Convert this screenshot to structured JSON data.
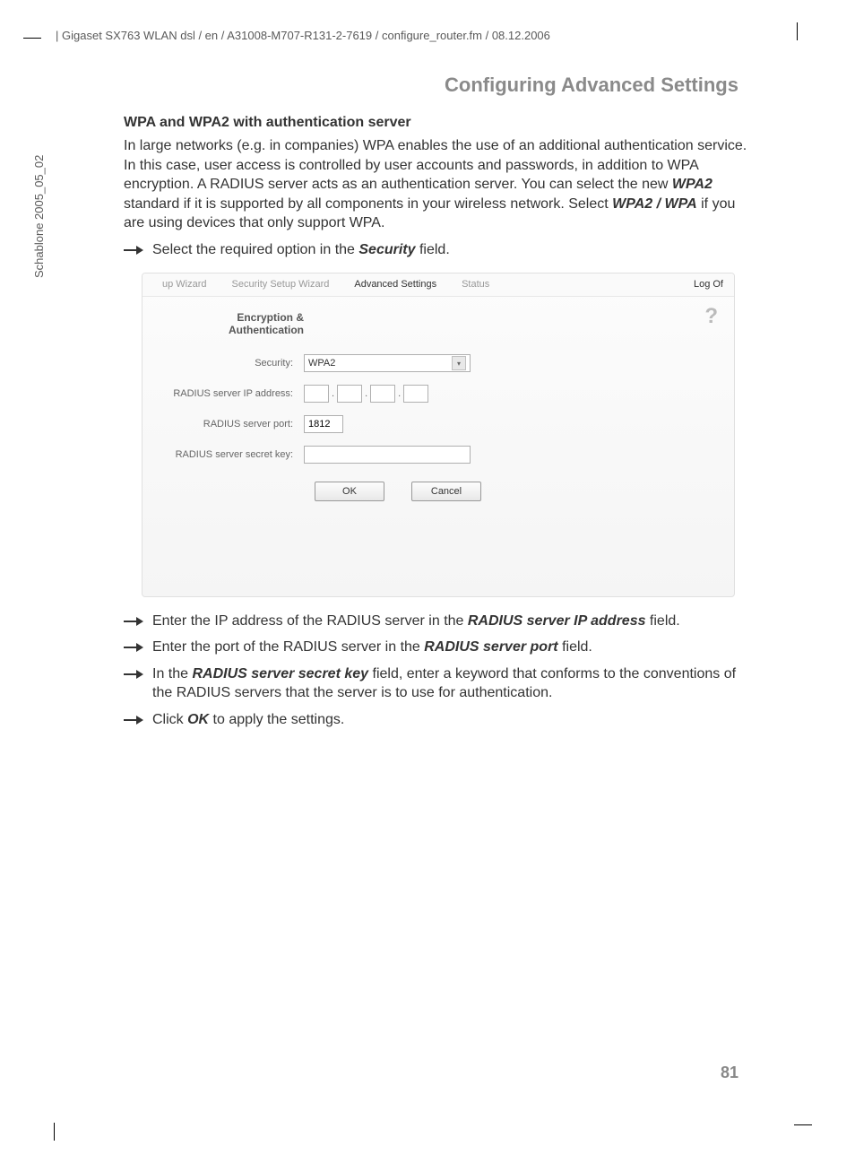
{
  "header_path": "Gigaset SX763 WLAN dsl / en / A31008-M707-R131-2-7619 / configure_router.fm / 08.12.2006",
  "vertical_note": "Schablone 2005_05_02",
  "section_title": "Configuring Advanced Settings",
  "subheading": "WPA and WPA2 with authentication server",
  "intro_1": "In large networks (e.g. in companies) WPA enables the use of an additional authentication service. In this case, user access is controlled by user accounts and passwords, in addition to WPA encryption. A RADIUS server acts as an authentication server. You can select the new ",
  "intro_bold1": "WPA2",
  "intro_2": " standard if it is supported by all components in your wireless network. Select ",
  "intro_bold2": "WPA2 / WPA",
  "intro_3": " if you are using devices that only support WPA.",
  "bullet1_a": "Select the required option in the ",
  "bullet1_bold": "Security",
  "bullet1_b": " field.",
  "tabs": {
    "t1": "up Wizard",
    "t2": "Security Setup Wizard",
    "t3": "Advanced Settings",
    "t4": "Status",
    "logoff": "Log Of"
  },
  "form": {
    "title_line1": "Encryption &",
    "title_line2": "Authentication",
    "security_label": "Security:",
    "security_value": "WPA2",
    "radius_ip_label": "RADIUS server IP address:",
    "radius_port_label": "RADIUS server port:",
    "radius_port_value": "1812",
    "radius_secret_label": "RADIUS server secret key:",
    "ok_button": "OK",
    "cancel_button": "Cancel",
    "help": "?"
  },
  "bullet2_a": "Enter the IP address of the RADIUS server in the ",
  "bullet2_bold": "RADIUS server IP address",
  "bullet2_b": " field.",
  "bullet3_a": "Enter the port of the RADIUS server in the ",
  "bullet3_bold": "RADIUS server port",
  "bullet3_b": " field.",
  "bullet4_a": "In the ",
  "bullet4_bold": "RADIUS server secret key",
  "bullet4_b": " field, enter a keyword that conforms to the conventions of the RADIUS servers that the server is to use for authentication.",
  "bullet5_a": "Click ",
  "bullet5_bold": "OK",
  "bullet5_b": " to apply the settings.",
  "page_number": "81"
}
